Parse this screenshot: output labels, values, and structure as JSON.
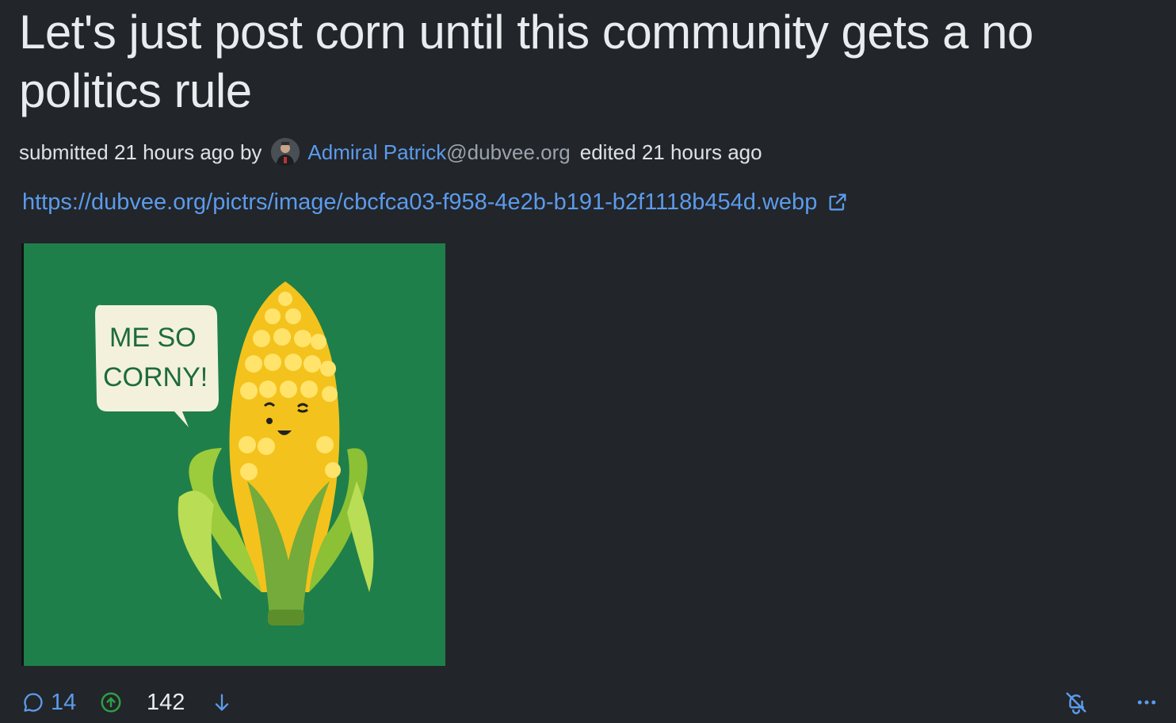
{
  "post": {
    "title": "Let's just post corn until this community gets a no politics rule",
    "submitted_text": "submitted 21 hours ago by",
    "author_name": "Admiral Patrick",
    "author_instance": "@dubvee.org",
    "edited_text": "edited 21 hours ago",
    "url": "https://dubvee.org/pictrs/image/cbcfca03-f958-4e2b-b191-b2f1118b454d.webp",
    "image": {
      "speech_line1": "ME SO",
      "speech_line2": "CORNY!",
      "background_color": "#1e7f4a"
    }
  },
  "footer": {
    "comment_count": "14",
    "score": "142"
  },
  "colors": {
    "background": "#222529",
    "link": "#5b9bec",
    "upvote": "#2f9e44"
  }
}
